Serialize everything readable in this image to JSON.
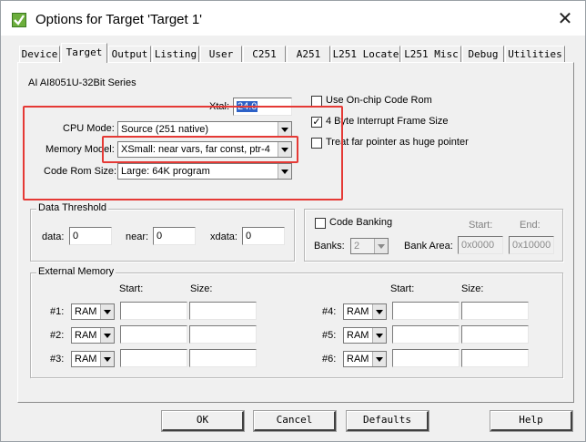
{
  "window": {
    "title": "Options for Target 'Target 1'",
    "close_glyph": "✕"
  },
  "tabs": [
    "Device",
    "Target",
    "Output",
    "Listing",
    "User",
    "C251",
    "A251",
    "L251 Locate",
    "L251 Misc",
    "Debug",
    "Utilities"
  ],
  "active_tab": "Target",
  "device_name": "AI AI8051U-32Bit Series",
  "xtal": {
    "label": "Xtal:",
    "value": "24.0"
  },
  "cpu_mode": {
    "label": "CPU Mode:",
    "value": "Source (251 native)"
  },
  "memory_model": {
    "label": "Memory Model:",
    "value": "XSmall: near vars, far const, ptr-4"
  },
  "code_rom_size": {
    "label": "Code Rom Size:",
    "value": "Large: 64K program"
  },
  "options": {
    "on_chip_code_rom": {
      "label": "Use On-chip Code Rom",
      "checked": false
    },
    "four_byte_interrupt": {
      "label": "4 Byte Interrupt Frame Size",
      "checked": true
    },
    "far_pointer_huge": {
      "label": "Treat far pointer as huge pointer",
      "checked": false
    }
  },
  "data_threshold": {
    "title": "Data Threshold",
    "data_label": "data:",
    "data_value": "0",
    "near_label": "near:",
    "near_value": "0",
    "xdata_label": "xdata:",
    "xdata_value": "0"
  },
  "code_banking": {
    "label": "Code Banking",
    "checked": false,
    "banks_label": "Banks:",
    "banks_value": "2",
    "bank_area_label": "Bank Area:",
    "start_header": "Start:",
    "end_header": "End:",
    "start_value": "0x0000",
    "end_value": "0x10000"
  },
  "external_memory": {
    "title": "External Memory",
    "start_header": "Start:",
    "size_header": "Size:",
    "rows_left": [
      {
        "label": "#1:",
        "type": "RAM",
        "start": "",
        "size": ""
      },
      {
        "label": "#2:",
        "type": "RAM",
        "start": "",
        "size": ""
      },
      {
        "label": "#3:",
        "type": "RAM",
        "start": "",
        "size": ""
      }
    ],
    "rows_right": [
      {
        "label": "#4:",
        "type": "RAM",
        "start": "",
        "size": ""
      },
      {
        "label": "#5:",
        "type": "RAM",
        "start": "",
        "size": ""
      },
      {
        "label": "#6:",
        "type": "RAM",
        "start": "",
        "size": ""
      }
    ]
  },
  "buttons": {
    "ok": "OK",
    "cancel": "Cancel",
    "defaults": "Defaults",
    "help": "Help"
  },
  "colors": {
    "highlight_box": "#e53935",
    "selection": "#2d62c8"
  }
}
